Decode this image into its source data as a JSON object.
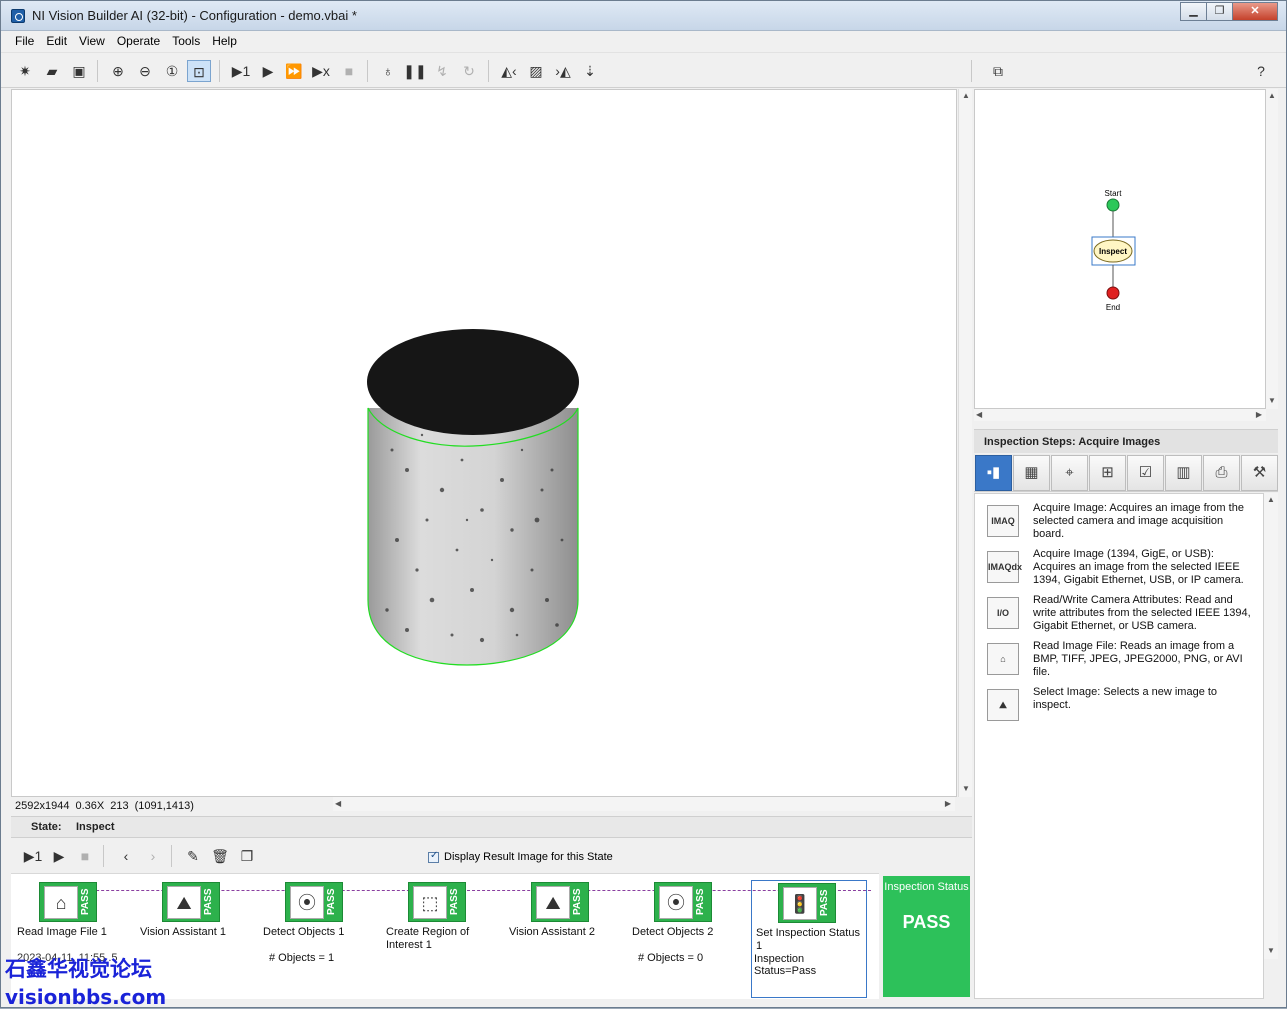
{
  "window": {
    "title": "NI Vision Builder AI (32-bit) - Configuration - demo.vbai *"
  },
  "menu": [
    "File",
    "Edit",
    "View",
    "Operate",
    "Tools",
    "Help"
  ],
  "toolbar": {
    "icons": [
      "new-icon",
      "open-icon",
      "save-icon",
      "zoom-in-icon",
      "zoom-out-icon",
      "zoom-actual-icon",
      "zoom-fit-icon",
      "run-once-icon",
      "run-icon",
      "run-continuous-icon",
      "run-cycle-icon",
      "stop-icon",
      "highlight-icon",
      "pause-icon",
      "step-over-icon",
      "step-back-icon",
      "prev-image-icon",
      "image-icon",
      "next-image-icon",
      "export-icon",
      "layout-icon",
      "help-icon"
    ]
  },
  "viewer": {
    "resolution": "2592x1944",
    "zoom": "0.36X",
    "pixel_value": "213",
    "coords": "(1091,1413)"
  },
  "state": {
    "label": "State:",
    "value": "Inspect"
  },
  "display_result": {
    "label": "Display Result Image for this State",
    "checked": true
  },
  "steps": [
    {
      "name": "Read Image File 1",
      "status": "PASS",
      "result": "2023-04-11, 11:55 .5"
    },
    {
      "name": "Vision Assistant 1",
      "status": "PASS",
      "result": ""
    },
    {
      "name": "Detect Objects 1",
      "status": "PASS",
      "result": "# Objects = 1"
    },
    {
      "name": "Create Region of Interest 1",
      "status": "PASS",
      "result": ""
    },
    {
      "name": "Vision Assistant 2",
      "status": "PASS",
      "result": ""
    },
    {
      "name": "Detect Objects 2",
      "status": "PASS",
      "result": "# Objects = 0"
    },
    {
      "name": "Set Inspection Status 1",
      "status": "PASS",
      "result": "Inspection Status=Pass"
    }
  ],
  "inspection_status": {
    "title": "Inspection Status",
    "value": "PASS",
    "color": "#2dc15a"
  },
  "flow": {
    "start": "Start",
    "inspect": "Inspect",
    "end": "End"
  },
  "steps_panel": {
    "header": "Inspection Steps: Acquire Images",
    "items": [
      {
        "icon": "IMAQ",
        "text": "Acquire Image:  Acquires an image from the selected camera and image acquisition board."
      },
      {
        "icon": "IMAQdx",
        "text": "Acquire Image (1394, GigE, or USB):  Acquires an image from the selected IEEE 1394, Gigabit Ethernet, USB, or IP camera."
      },
      {
        "icon": "I/O",
        "text": "Read/Write Camera Attributes:  Read and write attributes from the selected IEEE 1394, Gigabit Ethernet, or USB camera."
      },
      {
        "icon": "file",
        "text": "Read Image File:  Reads an image from a BMP, TIFF, JPEG, JPEG2000, PNG, or AVI file."
      },
      {
        "icon": "select",
        "text": "Select Image:  Selects a new image to inspect."
      }
    ]
  },
  "watermark": {
    "line1": "石鑫华视觉论坛",
    "line2": "visionbbs.com"
  }
}
